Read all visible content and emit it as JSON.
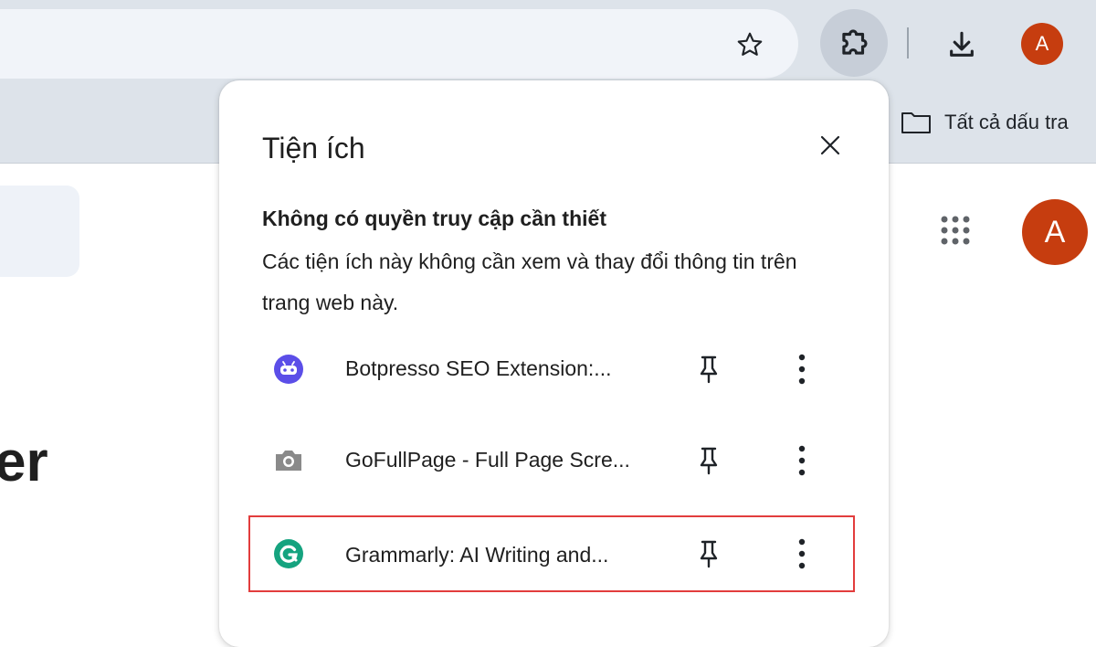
{
  "toolbar": {
    "profile_initial": "A",
    "profile_color": "#c63d0f"
  },
  "bookmarks": {
    "all_bookmarks_label": "Tất cả dấu tra"
  },
  "page": {
    "heading_fragment": "er",
    "profile_initial": "A"
  },
  "popup": {
    "title": "Tiện ích",
    "section_title": "Không có quyền truy cập cần thiết",
    "section_desc": "Các tiện ích này không cần xem và thay đổi thông tin trên trang web này.",
    "extensions": [
      {
        "name": "Botpresso SEO Extension:...",
        "icon": "botpresso-icon",
        "color": "#5b4ee8"
      },
      {
        "name": "GoFullPage - Full Page Scre...",
        "icon": "camera-icon",
        "color": "#8a8a8a"
      },
      {
        "name": "Grammarly: AI Writing and...",
        "icon": "grammarly-icon",
        "color": "#15a37f",
        "highlighted": true
      }
    ],
    "highlight_color": "#e23d3d"
  }
}
